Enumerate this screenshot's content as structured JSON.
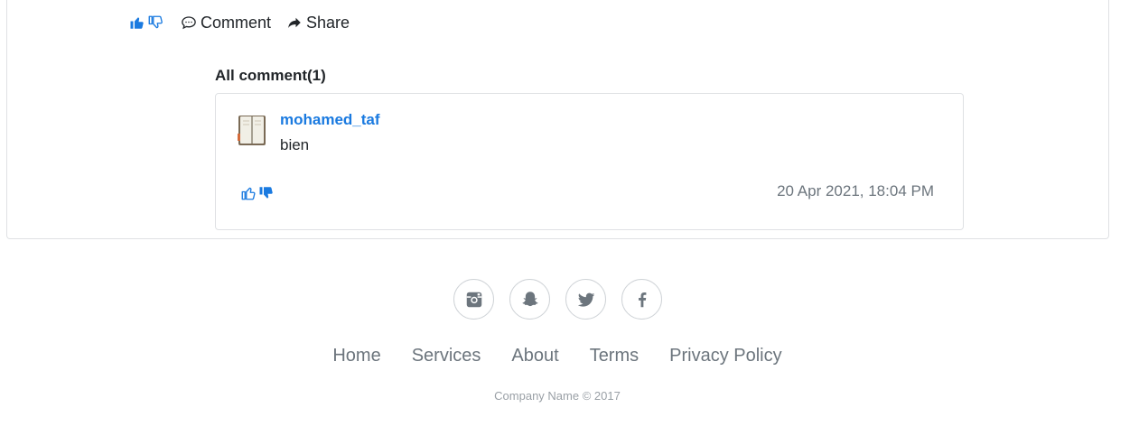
{
  "post": {
    "actions": {
      "comment_label": "Comment",
      "share_label": "Share"
    }
  },
  "comments": {
    "title": "All comment(1)",
    "items": [
      {
        "author": "mohamed_taf",
        "text": "bien",
        "date": "20 Apr 2021, 18:04 PM"
      }
    ]
  },
  "footer": {
    "social": [
      "instagram-icon",
      "snapchat-icon",
      "twitter-icon",
      "facebook-icon"
    ],
    "links": [
      "Home",
      "Services",
      "About",
      "Terms",
      "Privacy Policy"
    ],
    "copyright": "Company Name © 2017"
  },
  "colors": {
    "accent": "#1a7ae0",
    "muted": "#6c757d",
    "border": "#dfe1e4"
  }
}
